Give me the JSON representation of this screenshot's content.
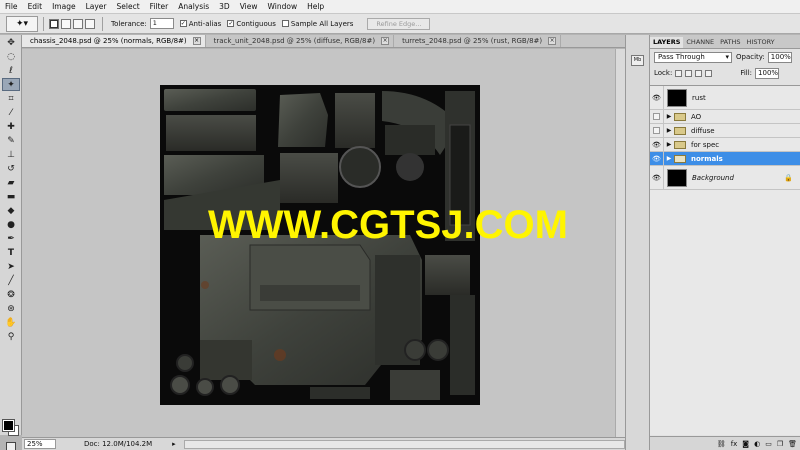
{
  "menu": [
    "File",
    "Edit",
    "Image",
    "Layer",
    "Select",
    "Filter",
    "Analysis",
    "3D",
    "View",
    "Window",
    "Help"
  ],
  "options": {
    "tolerance_label": "Tolerance:",
    "tolerance_value": "1",
    "anti_alias": "Anti-alias",
    "contiguous": "Contiguous",
    "sample_all": "Sample All Layers",
    "refine_edge": "Refine Edge..."
  },
  "tabs": [
    {
      "label": "chassis_2048.psd @ 25% (normals, RGB/8#)"
    },
    {
      "label": "track_unit_2048.psd @ 25% (diffuse, RGB/8#)"
    },
    {
      "label": "turrets_2048.psd @ 25% (rust, RGB/8#)"
    }
  ],
  "watermark": "WWW.CGTSJ.COM",
  "status": {
    "zoom": "25%",
    "doc_info": "Doc: 12.0M/104.2M"
  },
  "layers_panel": {
    "tabs": [
      "LAYERS",
      "CHANNE",
      "PATHS",
      "HISTORY"
    ],
    "blend_mode": "Pass Through",
    "opacity_label": "Opacity:",
    "opacity_value": "100%",
    "lock_label": "Lock:",
    "fill_label": "Fill:",
    "fill_value": "100%",
    "layers": [
      {
        "name": "rust"
      },
      {
        "name": "AO"
      },
      {
        "name": "diffuse"
      },
      {
        "name": "for spec"
      },
      {
        "name": "normals"
      },
      {
        "name": "Background"
      }
    ]
  },
  "colors": {
    "selection_blue": "#3d8ee7",
    "watermark_yellow": "#fff500"
  },
  "icons": [
    "magic-wand-icon",
    "eye-icon",
    "folder-icon",
    "lock-icon",
    "close-icon"
  ]
}
